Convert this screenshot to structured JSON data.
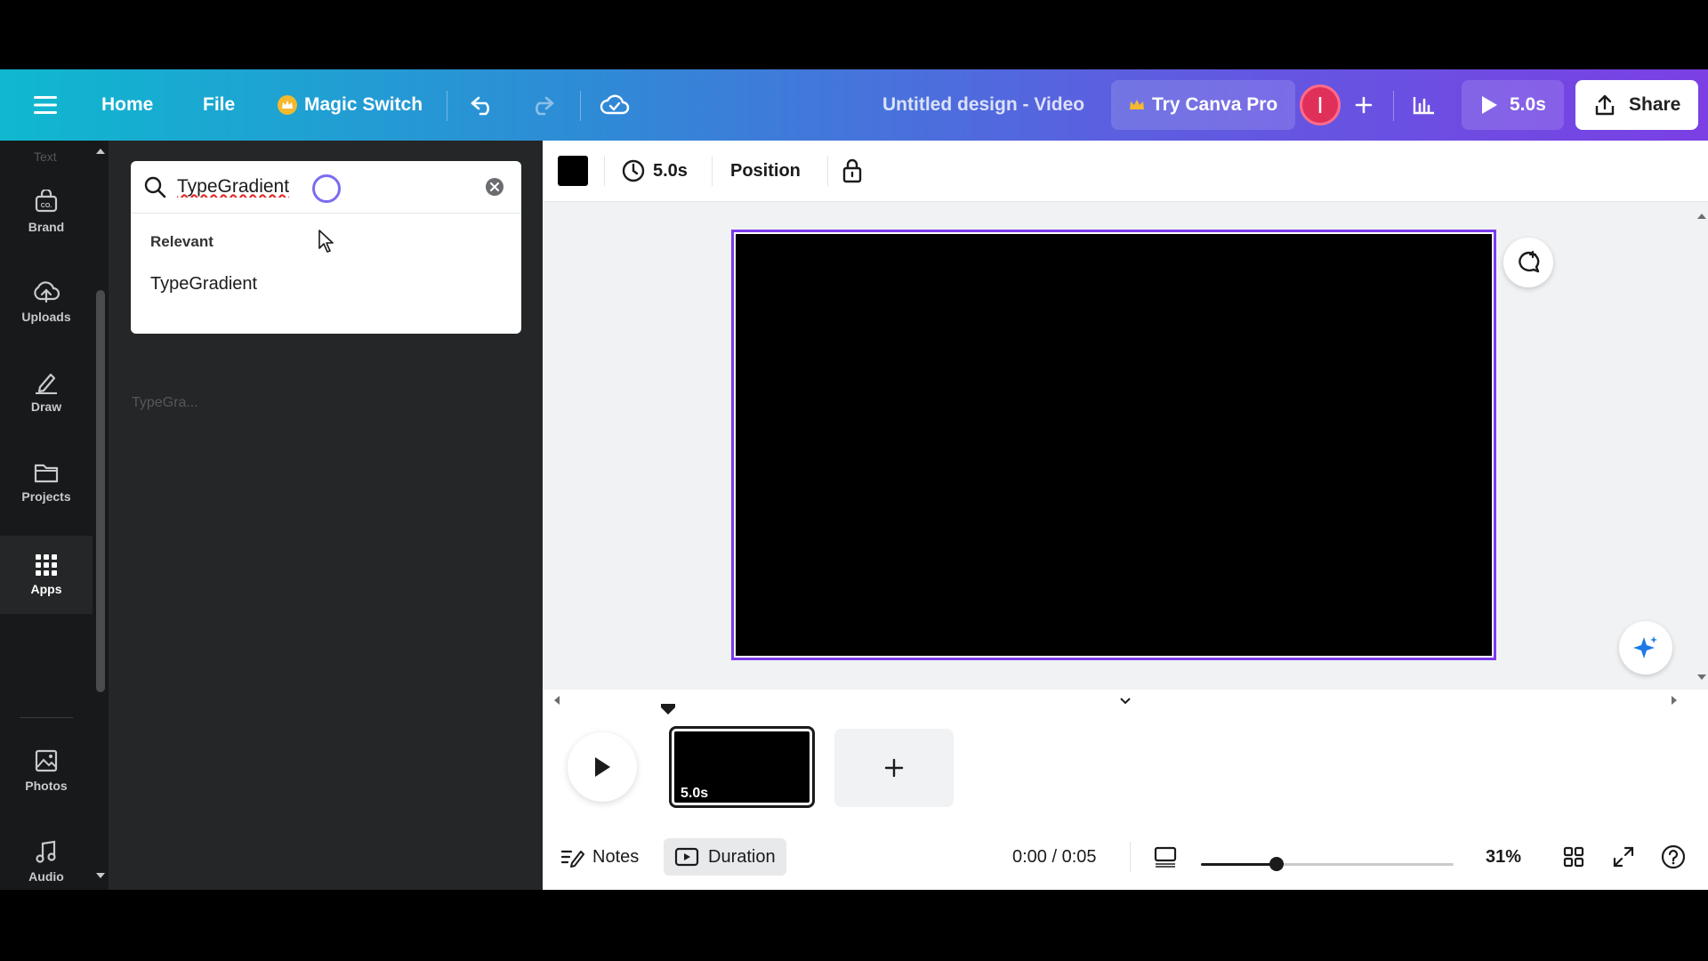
{
  "topbar": {
    "home": "Home",
    "file": "File",
    "magic_switch": "Magic Switch",
    "title": "Untitled design - Video",
    "try_pro": "Try Canva Pro",
    "avatar_initial": "I",
    "play_duration": "5.0s",
    "share": "Share"
  },
  "rail": {
    "ghost_top": "Text",
    "items": [
      {
        "label": "Brand",
        "icon": "brand-icon"
      },
      {
        "label": "Uploads",
        "icon": "cloud-upload-icon"
      },
      {
        "label": "Draw",
        "icon": "pen-icon"
      },
      {
        "label": "Projects",
        "icon": "folder-icon"
      },
      {
        "label": "Apps",
        "icon": "apps-grid-icon",
        "active": true
      },
      {
        "label": "Photos",
        "icon": "image-icon"
      },
      {
        "label": "Audio",
        "icon": "music-note-icon"
      }
    ]
  },
  "panel": {
    "search_value": "TypeGradient",
    "dropdown_heading": "Relevant",
    "dropdown_item": "TypeGradient",
    "ghost_result": "TypeGra..."
  },
  "editor_toolbar": {
    "color_swatch": "#000000",
    "duration": "5.0s",
    "position": "Position"
  },
  "timeline": {
    "clip_duration": "5.0s",
    "notes": "Notes",
    "duration_btn": "Duration",
    "time": "0:00 / 0:05",
    "zoom": "31%",
    "zoom_fraction": 0.3
  },
  "colors": {
    "accent": "#7c3aed",
    "avatar": "#e0305a"
  }
}
